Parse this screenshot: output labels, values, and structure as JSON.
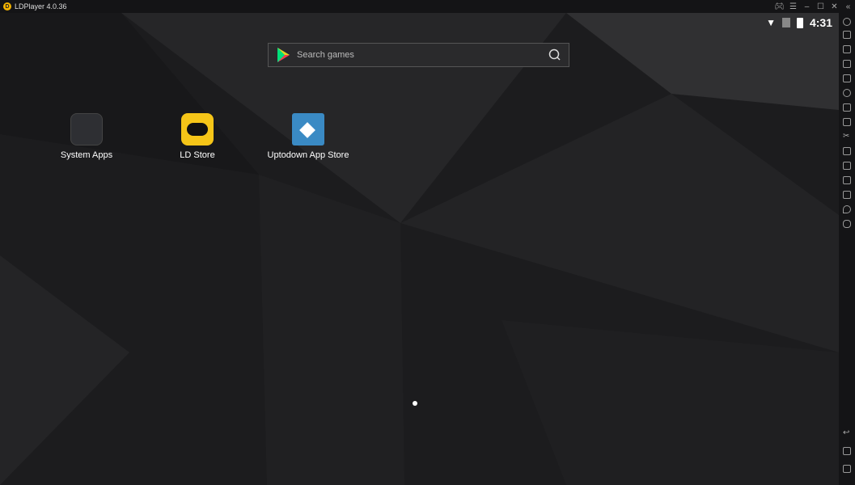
{
  "window": {
    "title": "LDPlayer 4.0.36"
  },
  "status_bar": {
    "time": "4:31"
  },
  "search": {
    "placeholder": "Search games"
  },
  "apps": [
    {
      "label": "System Apps"
    },
    {
      "label": "LD Store"
    },
    {
      "label": "Uptodown App Store"
    }
  ],
  "colors": {
    "ld_yellow": "#f5c518",
    "uptodown_blue": "#3a8ac4"
  }
}
